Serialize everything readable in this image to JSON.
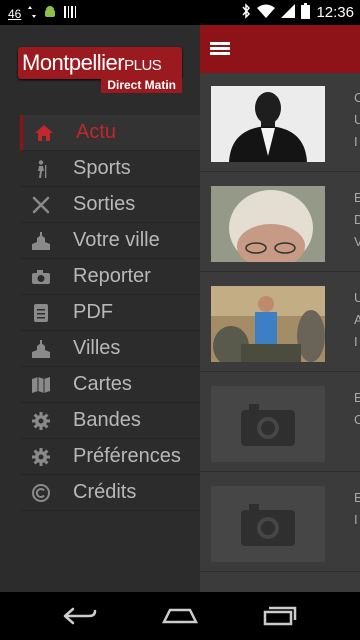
{
  "status_bar": {
    "network": "46",
    "time": "12:36"
  },
  "drawer": {
    "logo": {
      "brand": "Montpellier",
      "brand_suffix": "PLUS",
      "subtitle": "Direct Matin"
    },
    "items": [
      {
        "label": "Actu",
        "icon": "home-icon",
        "active": true
      },
      {
        "label": "Sports",
        "icon": "hiker-icon"
      },
      {
        "label": "Sorties",
        "icon": "cutlery-icon"
      },
      {
        "label": "Votre ville",
        "icon": "church-icon"
      },
      {
        "label": "Reporter",
        "icon": "camera-icon"
      },
      {
        "label": "PDF",
        "icon": "document-icon"
      },
      {
        "label": "Villes",
        "icon": "church-icon"
      },
      {
        "label": "Cartes",
        "icon": "map-icon"
      },
      {
        "label": "Bandes",
        "icon": "gear-icon"
      },
      {
        "label": "Préférences",
        "icon": "gear-icon"
      },
      {
        "label": "Crédits",
        "icon": "copyright-icon"
      }
    ]
  },
  "content": {
    "articles": [
      {
        "thumb": "photo-portrait",
        "lines": [
          "C",
          "U",
          "I"
        ]
      },
      {
        "thumb": "photo-elder",
        "lines": [
          "E",
          "D",
          "V",
          "F"
        ]
      },
      {
        "thumb": "photo-group",
        "lines": [
          "U",
          "A",
          "I"
        ]
      },
      {
        "thumb": "placeholder",
        "lines": [
          "E",
          "C"
        ]
      },
      {
        "thumb": "placeholder",
        "lines": [
          "E",
          "I"
        ]
      }
    ]
  },
  "colors": {
    "accent": "#8e1318",
    "active_text": "#c1272d"
  }
}
